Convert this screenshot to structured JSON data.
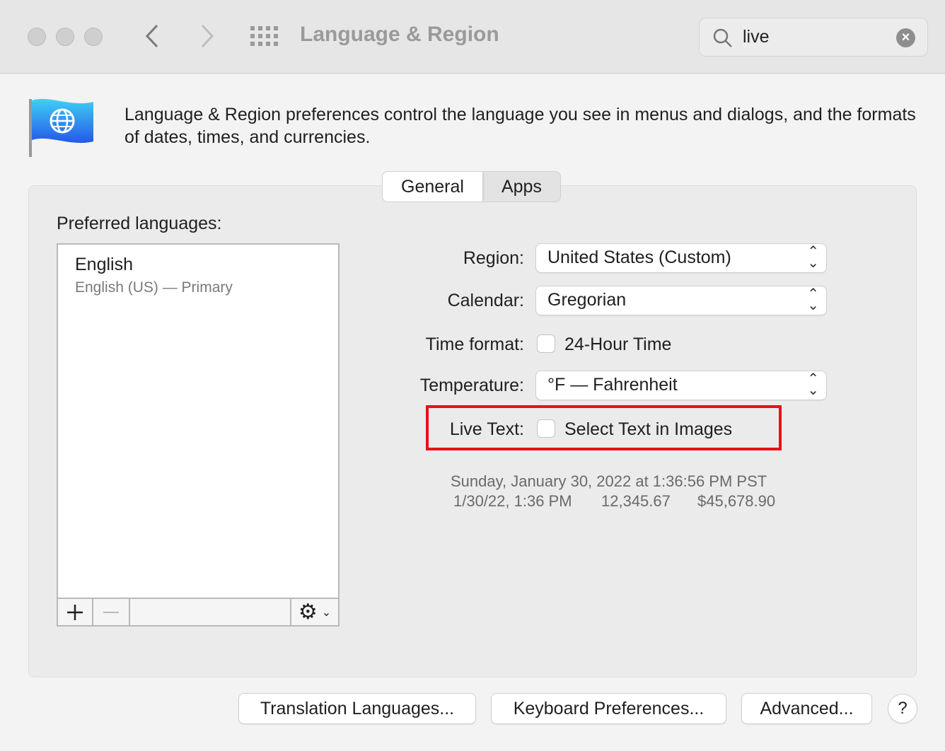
{
  "window": {
    "title": "Language & Region",
    "search_value": "live",
    "search_placeholder": "Search"
  },
  "description": "Language & Region preferences control the language you see in menus and dialogs, and the formats of dates, times, and currencies.",
  "tabs": [
    {
      "label": "General",
      "selected": true
    },
    {
      "label": "Apps",
      "selected": false
    }
  ],
  "preferred": {
    "label": "Preferred languages:",
    "items": [
      {
        "name": "English",
        "detail": "English (US) — Primary"
      }
    ]
  },
  "settings": {
    "region": {
      "label": "Region:",
      "value": "United States (Custom)"
    },
    "calendar": {
      "label": "Calendar:",
      "value": "Gregorian"
    },
    "time_format": {
      "label": "Time format:",
      "option": "24-Hour Time",
      "checked": false
    },
    "temperature": {
      "label": "Temperature:",
      "value": "°F — Fahrenheit"
    },
    "live_text": {
      "label": "Live Text:",
      "option": "Select Text in Images",
      "checked": false,
      "highlight_color": "#e8101a"
    }
  },
  "sample": {
    "long_date": "Sunday, January 30, 2022 at 1:36:56 PM PST",
    "short_date": "1/30/22, 1:36 PM",
    "number": "12,345.67",
    "currency": "$45,678.90"
  },
  "buttons": {
    "translation": "Translation Languages...",
    "keyboard": "Keyboard Preferences...",
    "advanced": "Advanced...",
    "help": "?"
  }
}
